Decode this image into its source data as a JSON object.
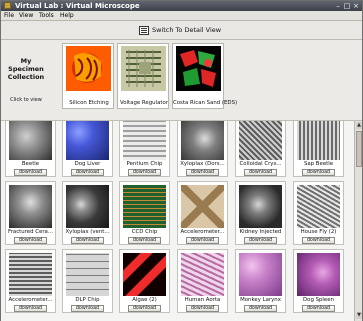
{
  "window": {
    "title": "Virtual Lab : Virtual Microscope",
    "controls": [
      "–",
      "□",
      "×"
    ]
  },
  "menu": [
    "File",
    "View",
    "Tools",
    "Help"
  ],
  "toolbar": {
    "detail_button": "Switch To Detail View"
  },
  "collection": {
    "title": "My Specimen Collection",
    "hint": "Click to view",
    "items": [
      {
        "label": "Silicon Etching",
        "colors": [
          "#ff7a00",
          "#c92b00"
        ]
      },
      {
        "label": "Voltage Regulator",
        "colors": [
          "#c8c8a0",
          "#5e6a45"
        ]
      },
      {
        "label": "Costa Rican Sand (EDS)",
        "colors": [
          "#e02a2a",
          "#2aa83b"
        ]
      }
    ]
  },
  "specimens": [
    {
      "label": "Beetle",
      "colors": [
        "#c8c8c8",
        "#4a4a4a"
      ]
    },
    {
      "label": "Dog Liver",
      "colors": [
        "#4a5cd8",
        "#1f2a7a"
      ]
    },
    {
      "label": "Pentium Chip",
      "colors": [
        "#d8d8d8",
        "#6e6e6e"
      ]
    },
    {
      "label": "Xyloplax (Dors...",
      "colors": [
        "#bcbcbc",
        "#545454"
      ]
    },
    {
      "label": "Colloidal Crys...",
      "colors": [
        "#a6a6a6",
        "#3c3c3c"
      ]
    },
    {
      "label": "Sap Beetle",
      "colors": [
        "#cfcfcf",
        "#5a5a5a"
      ]
    },
    {
      "label": "Fractured Cera...",
      "colors": [
        "#bdbdbd",
        "#4b4b4b"
      ]
    },
    {
      "label": "Xyloplax (vent...",
      "colors": [
        "#9a9a9a",
        "#2e2e2e"
      ]
    },
    {
      "label": "CCD Chip",
      "colors": [
        "#2e8a3a",
        "#b8842d"
      ]
    },
    {
      "label": "Accelerometer...",
      "colors": [
        "#d8c7a7",
        "#6c5a3a"
      ]
    },
    {
      "label": "Kidney Injected",
      "colors": [
        "#a5a5a5",
        "#333333"
      ]
    },
    {
      "label": "House Fly (2)",
      "colors": [
        "#c9c9c9",
        "#505050"
      ]
    },
    {
      "label": "Accelerometer...",
      "colors": [
        "#b0b0b0",
        "#3f3f3f"
      ]
    },
    {
      "label": "DLP Chip",
      "colors": [
        "#c7c7c7",
        "#555555"
      ]
    },
    {
      "label": "Algae (2)",
      "colors": [
        "#e62a2a",
        "#200000"
      ]
    },
    {
      "label": "Human Aorta",
      "colors": [
        "#e3b8d8",
        "#9a4d8a"
      ]
    },
    {
      "label": "Monkey Larynx",
      "colors": [
        "#d59ad4",
        "#7c3b8a"
      ]
    },
    {
      "label": "Dog Spleen",
      "colors": [
        "#c97ac9",
        "#5b2367"
      ]
    }
  ],
  "download_label": "download"
}
